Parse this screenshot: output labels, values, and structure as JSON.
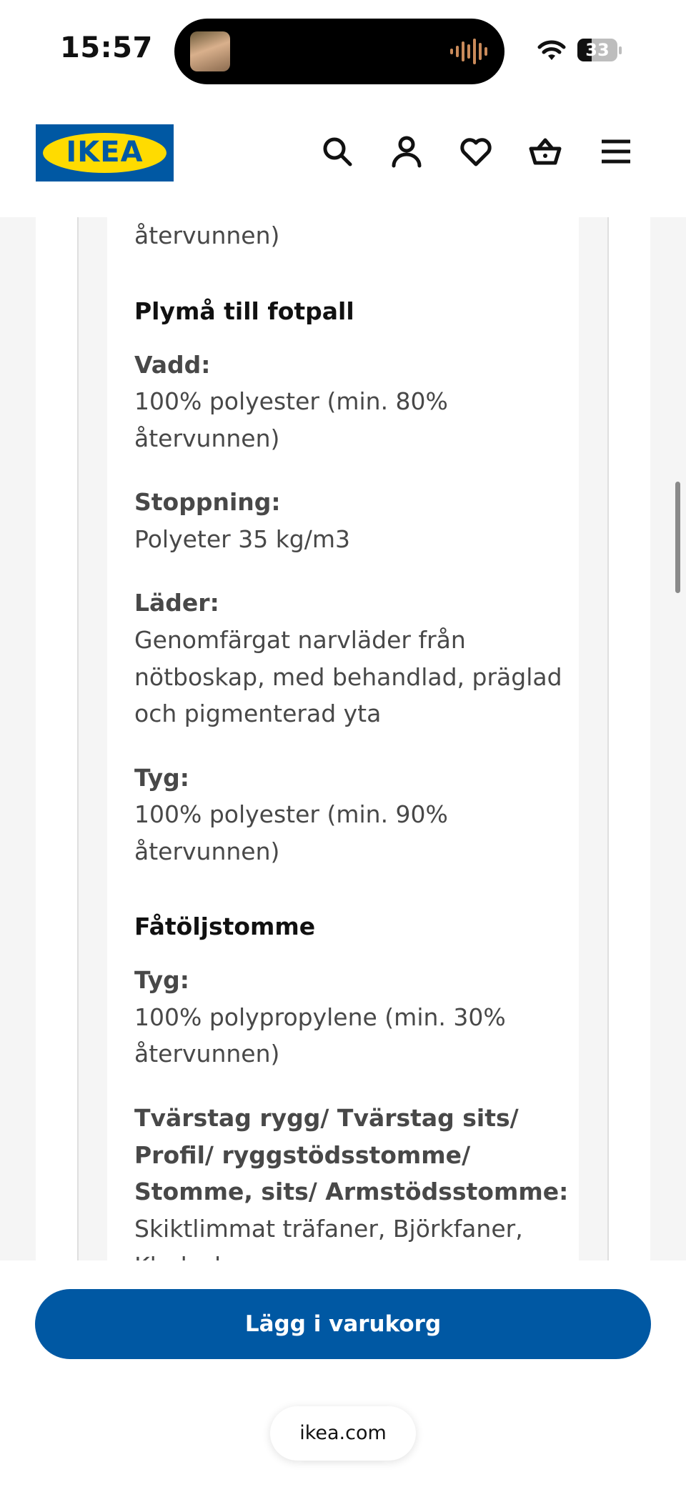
{
  "status_bar": {
    "time": "15:57",
    "battery": "33",
    "icons": [
      "contact-photo-icon",
      "audio-wave-icon",
      "wifi-icon",
      "battery-icon"
    ]
  },
  "header": {
    "logo_text": "IKEA",
    "icons": [
      "search-icon",
      "account-icon",
      "heart-icon",
      "cart-icon",
      "menu-icon"
    ]
  },
  "materials": {
    "top_cut_text": "återvunnen)",
    "sections": [
      {
        "title": "Plymå till fotpall",
        "items": [
          {
            "label": "Vadd:",
            "lines": [
              "100% polyester (min. 80%",
              "återvunnen)"
            ]
          },
          {
            "label": "Stoppning:",
            "lines": [
              "Polyeter 35 kg/m3"
            ]
          },
          {
            "label": "Läder:",
            "lines": [
              "Genomfärgat narvläder från",
              "nötboskap, med behandlad, präglad",
              "och pigmenterad yta"
            ]
          },
          {
            "label": "Tyg:",
            "lines": [
              "100% polyester (min. 90%",
              "återvunnen)"
            ]
          }
        ]
      },
      {
        "title": "Fåtöljstomme",
        "items": [
          {
            "label": "Tyg:",
            "lines": [
              "100% polypropylene (min. 30%",
              "återvunnen)"
            ]
          },
          {
            "label_lines": [
              "Tvärstag rygg/ Tvärstag sits/",
              "Profil/ ryggstödsstomme/",
              "Stomme, sits/ Armstödsstomme:"
            ],
            "lines": [
              "Skiktlimmat träfaner, Björkfaner,",
              "Klarlack"
            ]
          }
        ]
      }
    ]
  },
  "cta": {
    "label": "Lägg i varukorg"
  },
  "browser": {
    "url": "ikea.com"
  },
  "colors": {
    "brand_blue": "#0058a3",
    "brand_yellow": "#ffdb00"
  }
}
